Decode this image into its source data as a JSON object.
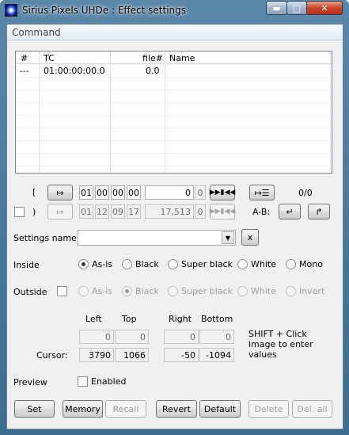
{
  "window": {
    "title": "Sirius Pixels UHDe : Effect settings",
    "min_icon": "minimize-icon",
    "max_icon": "maximize-icon",
    "close_icon": "close-icon"
  },
  "menu": {
    "command": "Command"
  },
  "list": {
    "headers": [
      "#",
      "TC",
      "file#",
      "Name"
    ],
    "rows": [
      {
        "num": "---",
        "tc": "01:00:00:00.0",
        "file": "0.0",
        "name": ""
      }
    ]
  },
  "timecode": {
    "in_bracket": "[",
    "out_bracket": ")",
    "in_tc": [
      "01",
      "00",
      "00",
      "00"
    ],
    "in_frame": "0",
    "in_field": "0",
    "out_tc": [
      "01",
      "12",
      "09",
      "17"
    ],
    "out_frame": "17,513",
    "out_field": "0",
    "counter": "0/0",
    "ab_label": "A-B:"
  },
  "settings": {
    "label": "Settings name",
    "value": "",
    "clear": "x"
  },
  "inside": {
    "label": "Inside",
    "options": [
      "As-is",
      "Black",
      "Super black",
      "White",
      "Mono"
    ],
    "selected": "As-is"
  },
  "outside": {
    "label": "Outside",
    "options": [
      "As-is",
      "Black",
      "Super black",
      "White",
      "Invert"
    ],
    "selected": "Black"
  },
  "cursor": {
    "headers": [
      "Left",
      "Top",
      "Right",
      "Bottom"
    ],
    "row_label": "Cursor:",
    "top_values": [
      "0",
      "0",
      "0",
      "0"
    ],
    "values": [
      "3790",
      "1066",
      "-50",
      "-1094"
    ],
    "hint": "SHIFT + Click image to enter values"
  },
  "preview": {
    "label": "Preview",
    "enabled_label": "Enabled"
  },
  "buttons": {
    "set": "Set",
    "memory": "Memory",
    "recall": "Recall",
    "revert": "Revert",
    "default": "Default",
    "delete": "Delete",
    "delall": "Del. all"
  }
}
